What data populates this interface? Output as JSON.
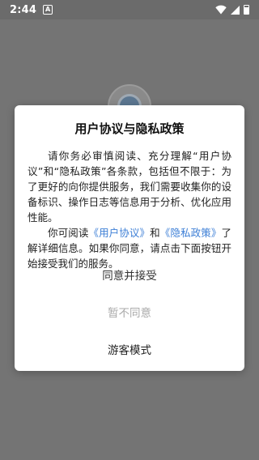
{
  "status_bar": {
    "time": "2:44",
    "notification_letter": "A",
    "icons": [
      "wifi-icon",
      "signal-icon",
      "battery-icon"
    ]
  },
  "background_app": {
    "logo_icon": "app-logo-icon"
  },
  "dialog": {
    "title": "用户协议与隐私政策",
    "paragraph1": "请你务必审慎阅读、充分理解“用户协议”和“隐私政策”各条款，包括但不限于：为了更好的向你提供服务，我们需要收集你的设备标识、操作日志等信息用于分析、优化应用性能。",
    "p2_prefix": "你可阅读",
    "user_agreement_link": "《用户协议》",
    "p2_and": "和",
    "privacy_policy_link": "《隐私政策》",
    "p2_suffix": "了解详细信息。如果你同意，请点击下面按钮开始接受我们的服务。",
    "buttons": {
      "agree": "同意并接受",
      "disagree": "暂不同意",
      "guest": "游客模式"
    }
  },
  "colors": {
    "overlay_background": "#747474",
    "link": "#3d7fd6",
    "disabled_text": "#aaaaaa"
  }
}
